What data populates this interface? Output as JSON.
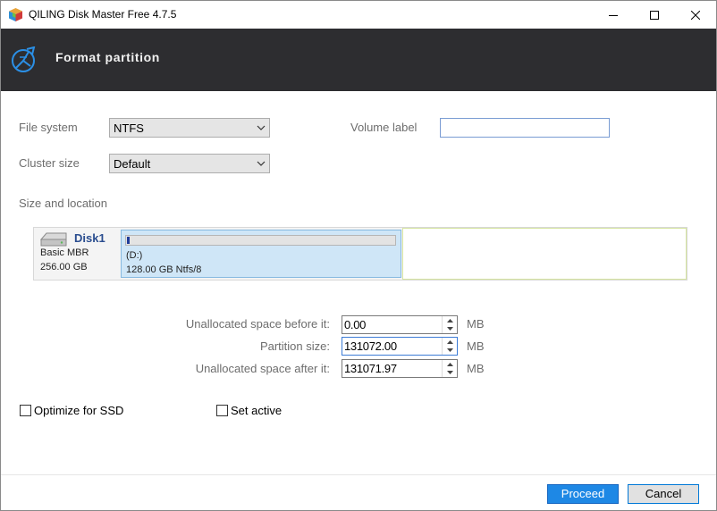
{
  "window": {
    "title": "QILING Disk Master Free 4.7.5",
    "minimize_icon": "minimize-icon",
    "maximize_icon": "maximize-icon",
    "close_icon": "close-icon"
  },
  "header": {
    "title": "Format partition",
    "icon": "disk-tool-icon"
  },
  "form": {
    "file_system_label": "File system",
    "file_system_value": "NTFS",
    "cluster_size_label": "Cluster size",
    "cluster_size_value": "Default",
    "volume_label_label": "Volume label",
    "volume_label_value": "",
    "size_location_label": "Size and location"
  },
  "disk": {
    "name": "Disk1",
    "type": "Basic MBR",
    "size": "256.00 GB",
    "partition_letter": "(D:)",
    "partition_detail": "128.00 GB Ntfs/8",
    "partition_used_fraction": 0.01
  },
  "sizes": {
    "before_label": "Unallocated space before it:",
    "before_value": "0.00",
    "partition_label": "Partition size:",
    "partition_value": "131072.00",
    "after_label": "Unallocated space after it:",
    "after_value": "131071.97",
    "unit": "MB"
  },
  "options": {
    "optimize_ssd_label": "Optimize for SSD",
    "set_active_label": "Set active"
  },
  "buttons": {
    "proceed": "Proceed",
    "cancel": "Cancel"
  },
  "colors": {
    "header_bg": "#2d2d30",
    "accent": "#1e88e5",
    "partition_bg": "#cfe6f7"
  }
}
